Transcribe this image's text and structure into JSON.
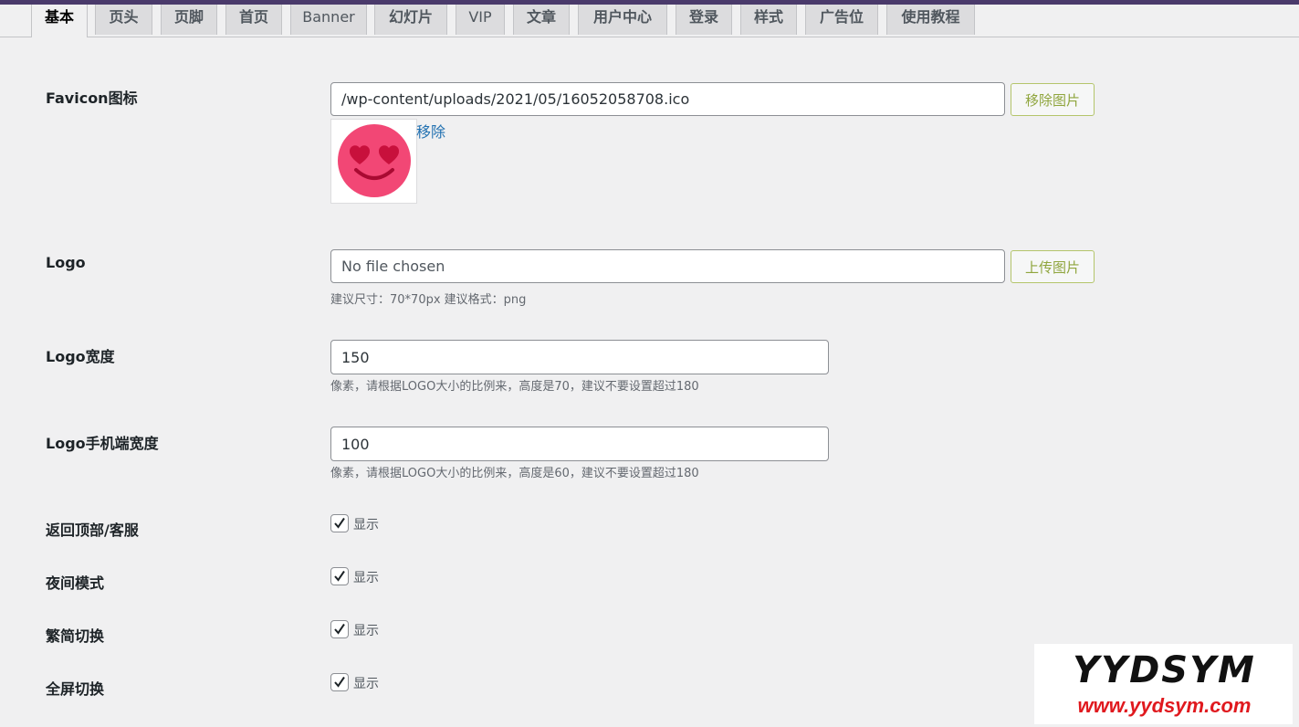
{
  "tabs": [
    "基本",
    "页头",
    "页脚",
    "首页",
    "Banner",
    "幻灯片",
    "VIP",
    "文章",
    "用户中心",
    "登录",
    "样式",
    "广告位",
    "使用教程"
  ],
  "fields": {
    "favicon": {
      "label": "Favicon图标",
      "value": "/wp-content/uploads/2021/05/16052058708.ico",
      "button": "移除图片",
      "remove_link": "移除"
    },
    "logo": {
      "label": "Logo",
      "value": "No file chosen",
      "button": "上传图片",
      "hint": "建议尺寸：70*70px 建议格式：png"
    },
    "logo_width": {
      "label": "Logo宽度",
      "value": "150",
      "hint": "像素，请根据LOGO大小的比例来，高度是70，建议不要设置超过180"
    },
    "logo_mobile_width": {
      "label": "Logo手机端宽度",
      "value": "100",
      "hint": "像素，请根据LOGO大小的比例来，高度是60，建议不要设置超过180"
    },
    "back_to_top": {
      "label": "返回顶部/客服",
      "checkbox": "显示",
      "checked": true
    },
    "night_mode": {
      "label": "夜间模式",
      "checkbox": "显示",
      "checked": true
    },
    "trad_simp": {
      "label": "繁简切换",
      "checkbox": "显示",
      "checked": true
    },
    "fullscreen": {
      "label": "全屏切换",
      "checkbox": "显示",
      "checked": true
    }
  },
  "watermark": {
    "brand": "YYDSYM",
    "url": "www.yydsym.com"
  },
  "colors": {
    "accent": "#2271b1",
    "button_text": "#8fa53d",
    "topbar": "#4a3a6b",
    "watermark_red": "#e0191e"
  }
}
